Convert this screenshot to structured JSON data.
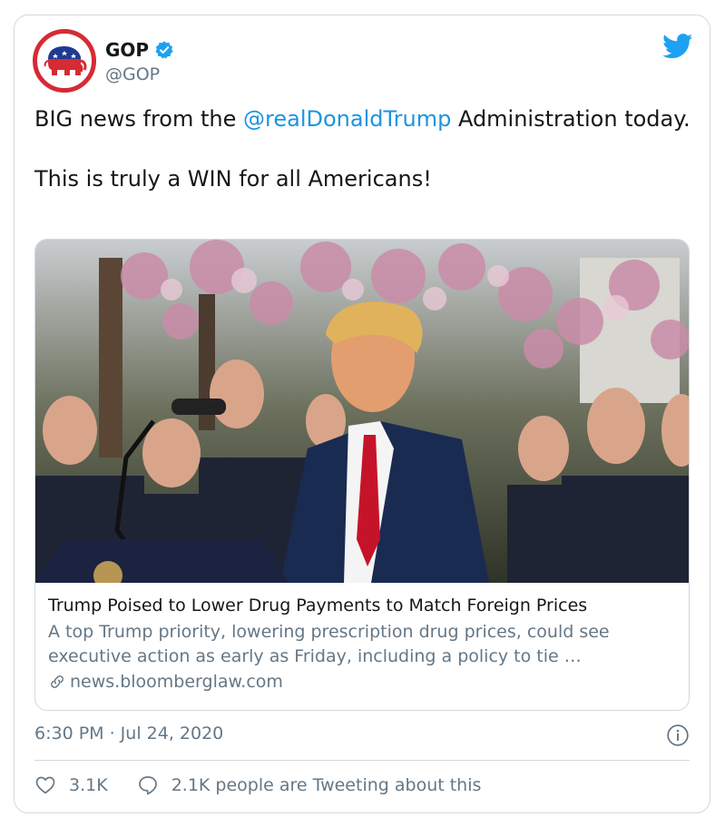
{
  "tweet": {
    "author": {
      "display_name": "GOP",
      "handle": "@GOP",
      "verified": true
    },
    "text": {
      "before_mention": "BIG news from the ",
      "mention": "@realDonaldTrump",
      "after_mention": " Administration today.",
      "second_paragraph": "This is truly a WIN for all Americans!"
    },
    "link_card": {
      "title": "Trump Poised to Lower Drug Payments to Match Foreign Prices",
      "description": "A top Trump priority, lowering prescription drug prices, could see executive action as early as Friday, including a policy to tie …",
      "domain": "news.bloomberglaw.com"
    },
    "timestamp": "6:30 PM · Jul 24, 2020",
    "likes": "3.1K",
    "tweeting_about": "2.1K people are Tweeting about this"
  },
  "icons": {
    "avatar": "gop-elephant-logo",
    "verified": "verified-badge-icon",
    "brand": "twitter-bird-icon",
    "link": "link-icon",
    "info": "info-icon",
    "like": "heart-icon",
    "reply": "speech-bubble-icon"
  },
  "colors": {
    "text": "#14171a",
    "secondary": "#657786",
    "link": "#1b95e0",
    "twitter_blue": "#1da1f2",
    "gop_red": "#d52b34",
    "border": "#cfd9de"
  }
}
